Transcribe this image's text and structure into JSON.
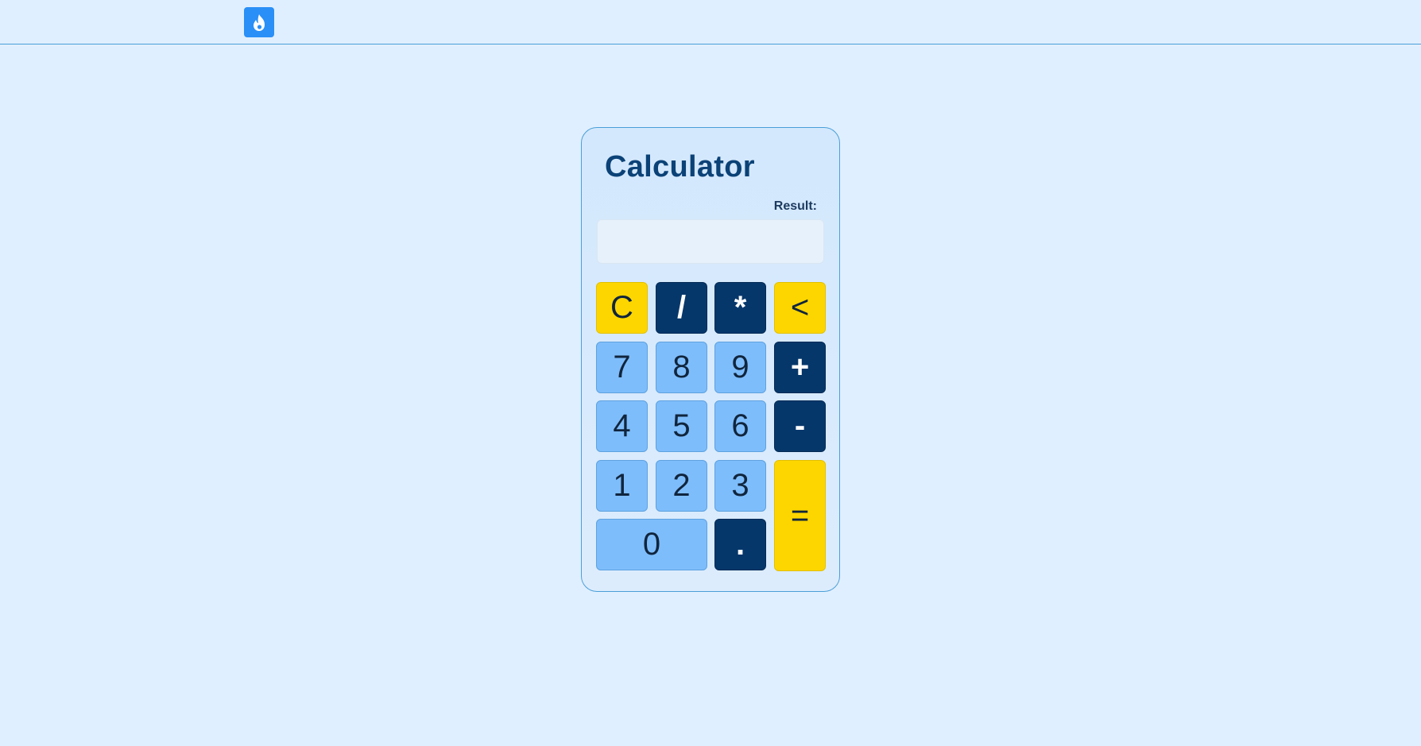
{
  "header": {
    "logo_icon": "flame-icon",
    "brand_color": "#2a8ff7"
  },
  "calculator": {
    "title": "Calculator",
    "result_label": "Result:",
    "result_value": "",
    "keys": {
      "clear": "C",
      "divide": "/",
      "multiply": "*",
      "backspace": "<",
      "seven": "7",
      "eight": "8",
      "nine": "9",
      "plus": "+",
      "four": "4",
      "five": "5",
      "six": "6",
      "minus": "-",
      "one": "1",
      "two": "2",
      "three": "3",
      "equals": "=",
      "zero": "0",
      "decimal": "."
    }
  },
  "colors": {
    "background": "#e0efff",
    "number_key": "#7ebdfb",
    "operator_key": "#06376b",
    "function_key": "#fdd600",
    "title": "#0b4277"
  }
}
